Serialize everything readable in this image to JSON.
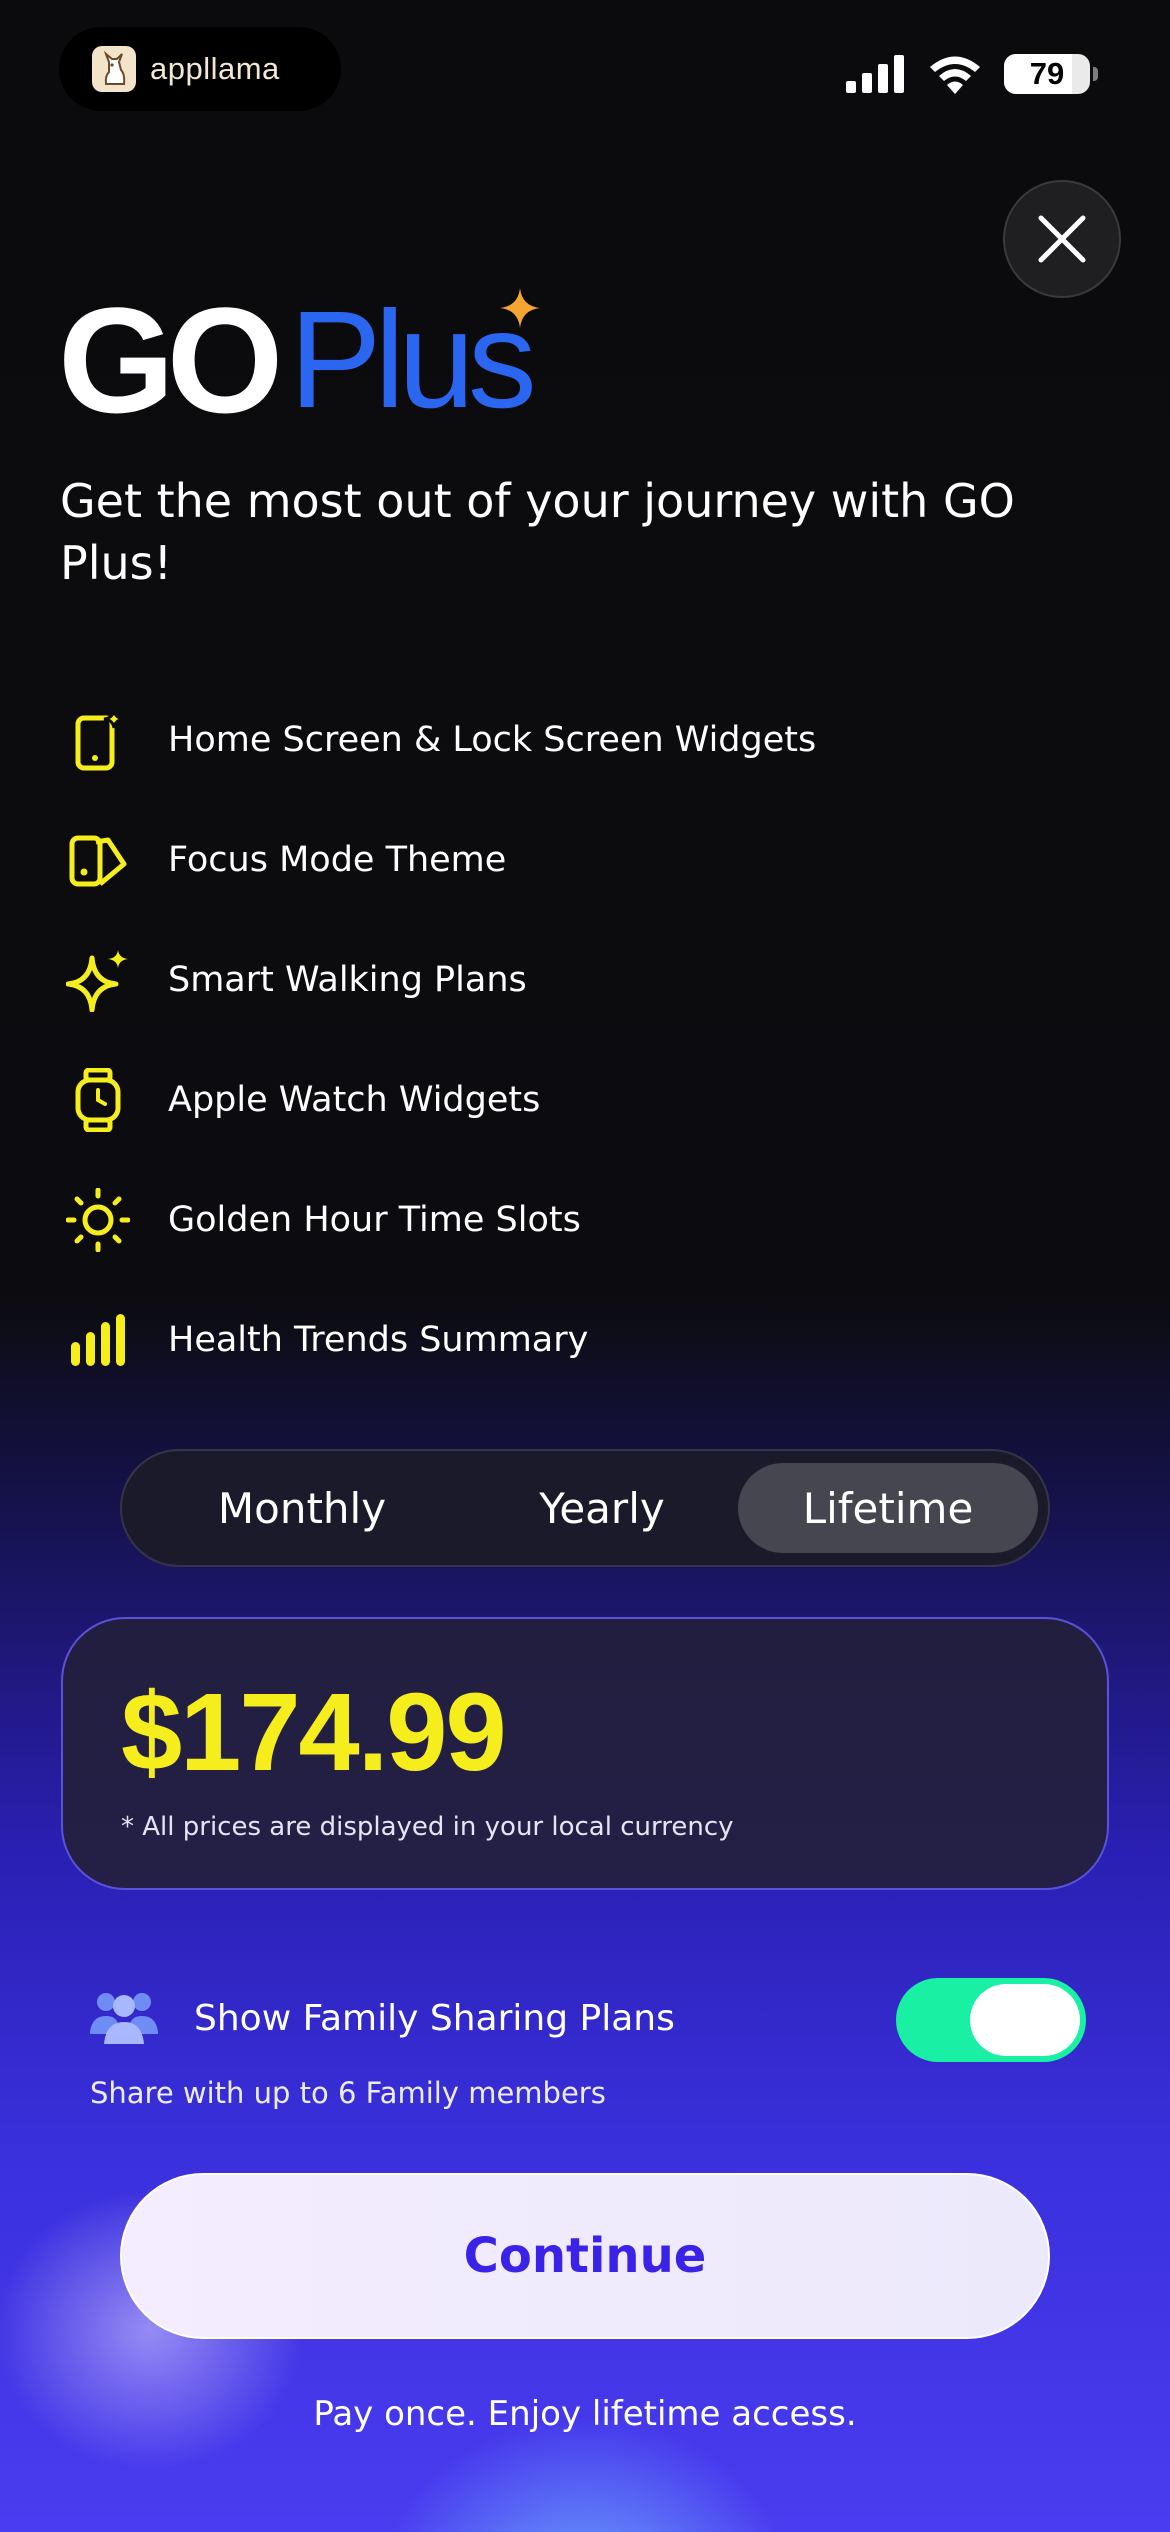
{
  "status_bar": {
    "brand_name": "appllama",
    "battery_percent": 79,
    "battery_text": "79"
  },
  "logo": {
    "part1": "GO",
    "part2": "Plus"
  },
  "headline": "Get the most out of your journey with GO Plus!",
  "features": [
    {
      "icon": "phone-sparkle-icon",
      "label": "Home Screen & Lock Screen Widgets"
    },
    {
      "icon": "theme-tag-icon",
      "label": "Focus Mode Theme"
    },
    {
      "icon": "sparkle-icon",
      "label": "Smart Walking Plans"
    },
    {
      "icon": "watch-icon",
      "label": "Apple Watch Widgets"
    },
    {
      "icon": "sun-icon",
      "label": "Golden Hour Time Slots"
    },
    {
      "icon": "bar-chart-icon",
      "label": "Health Trends Summary"
    }
  ],
  "plans": {
    "options": [
      "Monthly",
      "Yearly",
      "Lifetime"
    ],
    "selected": "Lifetime"
  },
  "price": {
    "amount": "$174.99",
    "note": "* All prices are displayed in your local currency"
  },
  "family_sharing": {
    "label": "Show Family Sharing Plans",
    "subtitle": "Share with up to 6 Family members",
    "enabled": true
  },
  "continue_label": "Continue",
  "footer_text": "Pay once. Enjoy lifetime access.",
  "colors": {
    "accent_yellow": "#f5ee1c",
    "logo_blue": "#2b66f0",
    "toggle_green": "#19f0a4",
    "continue_text": "#3a22e6"
  }
}
